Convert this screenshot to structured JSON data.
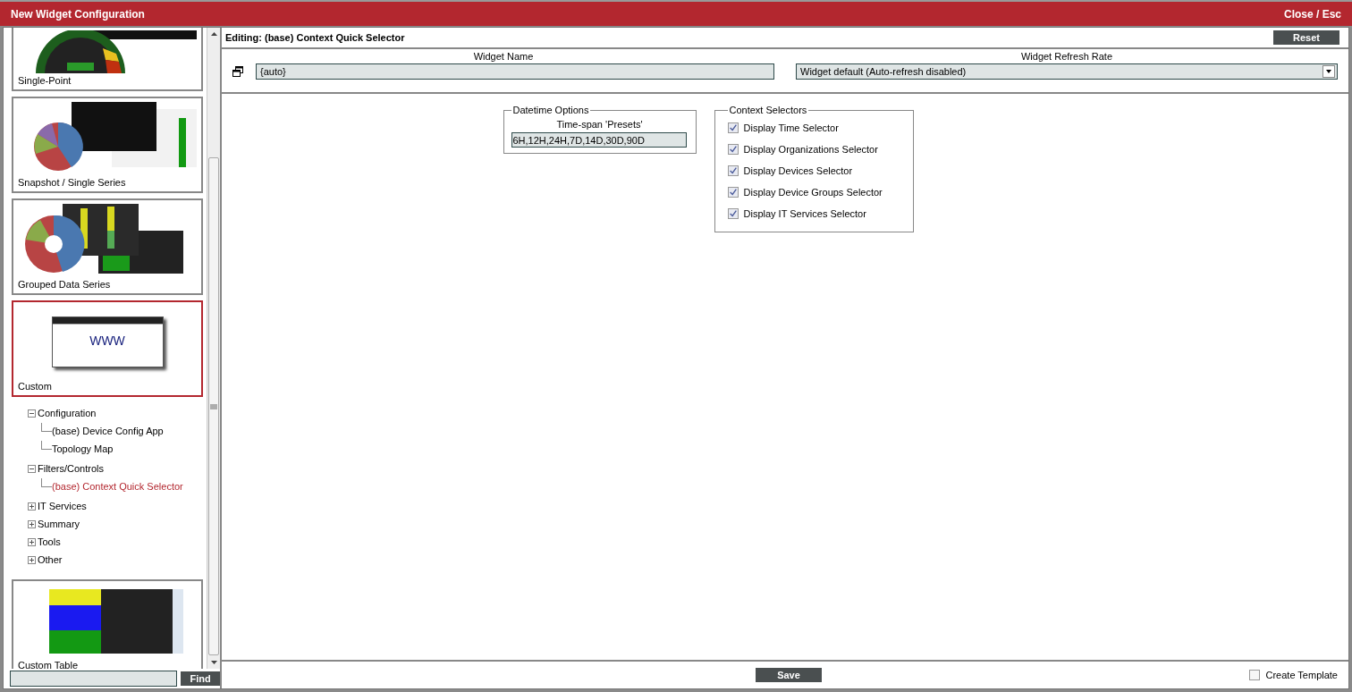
{
  "window": {
    "title": "New Widget Configuration",
    "close_label": "Close / Esc"
  },
  "sidebar": {
    "items": [
      {
        "label": "Single-Point",
        "kind": "card",
        "selected": false
      },
      {
        "label": "Snapshot / Single Series",
        "kind": "card",
        "selected": false
      },
      {
        "label": "Grouped Data Series",
        "kind": "card",
        "selected": false
      },
      {
        "label": "Custom",
        "kind": "card",
        "selected": true,
        "www_text": "WWW",
        "children": [
          {
            "label": "Configuration",
            "expanded": true,
            "children": [
              {
                "label": "(base) Device Config App",
                "selected": false
              },
              {
                "label": "Topology Map",
                "selected": false
              }
            ]
          },
          {
            "label": "Filters/Controls",
            "expanded": true,
            "children": [
              {
                "label": "(base) Context Quick Selector",
                "selected": true
              }
            ]
          },
          {
            "label": "IT Services",
            "expanded": false
          },
          {
            "label": "Summary",
            "expanded": false
          },
          {
            "label": "Tools",
            "expanded": false
          },
          {
            "label": "Other",
            "expanded": false
          }
        ]
      },
      {
        "label": "Custom Table",
        "kind": "card",
        "selected": false
      }
    ],
    "find_button": "Find"
  },
  "editor": {
    "title": "Editing: (base) Context Quick Selector",
    "reset_button": "Reset",
    "widget_name": {
      "label": "Widget Name",
      "value": "{auto}"
    },
    "refresh_rate": {
      "label": "Widget Refresh Rate",
      "value": "Widget default (Auto-refresh disabled)"
    },
    "datetime_options": {
      "legend": "Datetime Options",
      "label": "Time-span 'Presets'",
      "value": "6H,12H,24H,7D,14D,30D,90D"
    },
    "context_selectors": {
      "legend": "Context Selectors",
      "options": [
        {
          "label": "Display Time Selector",
          "checked": true
        },
        {
          "label": "Display Organizations Selector",
          "checked": true
        },
        {
          "label": "Display Devices Selector",
          "checked": true
        },
        {
          "label": "Display Device Groups Selector",
          "checked": true
        },
        {
          "label": "Display IT Services Selector",
          "checked": true
        }
      ]
    },
    "save_button": "Save",
    "create_template": {
      "label": "Create Template",
      "checked": false
    }
  }
}
